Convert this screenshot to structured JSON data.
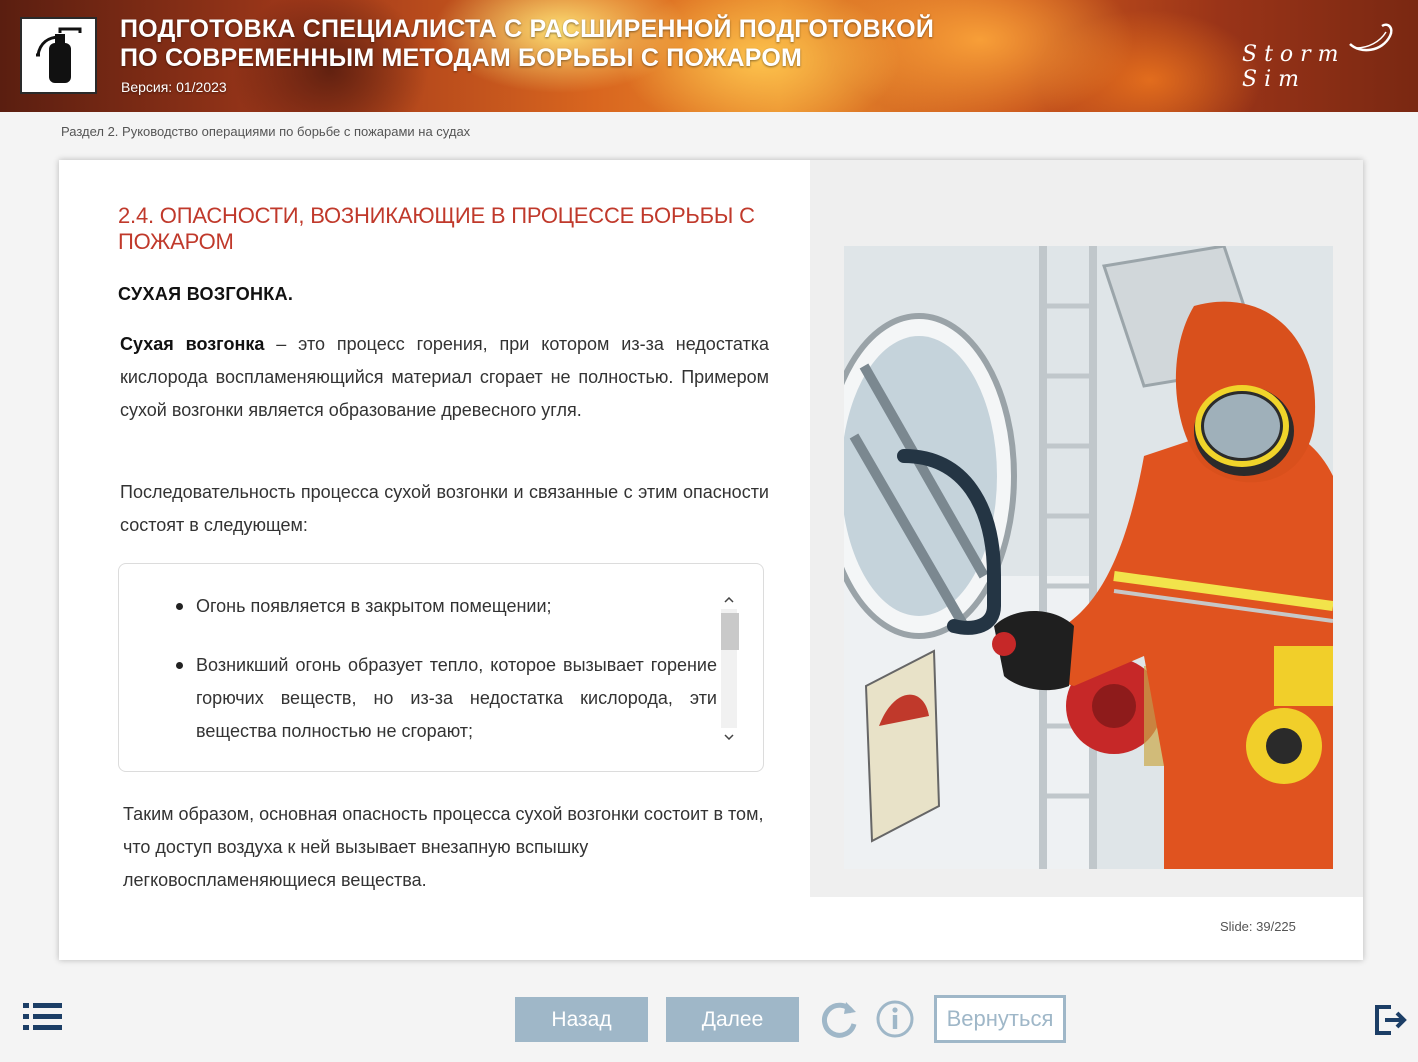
{
  "header": {
    "title_line1": "ПОДГОТОВКА СПЕЦИАЛИСТА С РАСШИРЕННОЙ ПОДГОТОВКОЙ",
    "title_line2": "ПО СОВРЕМЕННЫМ МЕТОДАМ БОРЬБЫ С ПОЖАРОМ",
    "version": "Версия: 01/2023",
    "logo_icon": "fire-extinguisher-icon",
    "brand_name": "Storm Sim"
  },
  "breadcrumb": "Раздел 2. Руководство операциями по борьбе с пожарами на судах",
  "content": {
    "section_title": "2.4. ОПАСНОСТИ, ВОЗНИКАЮЩИЕ В ПРОЦЕССЕ БОРЬБЫ С ПОЖАРОМ",
    "subheading": "СУХАЯ ВОЗГОНКА.",
    "p1_term": "Сухая возгонка",
    "p1_rest": " – это процесс горения, при котором из-за недостатка кислорода воспламеняющийся материал сгорает не полностью. Примером сухой возгонки является образование древесного угля.",
    "p2": "Последовательность процесса сухой возгонки и связанные с этим опасности состоят в следующем:",
    "bullets": [
      "Огонь появляется в закрытом помещении;",
      "Возникший огонь образует тепло, которое вызывает горение горючих веществ, но из-за недостатка кислорода, эти вещества полностью не сгорают;"
    ],
    "p3": "Таким образом, основная опасность процесса сухой возгонки состоит в том, что доступ воздуха к ней вызывает внезапную вспышку легковоспламеняющиеся вещества.",
    "slide_counter": "Slide: 39/225"
  },
  "footer": {
    "back_label": "Назад",
    "next_label": "Далее",
    "return_label": "Вернуться",
    "accent_color": "#9fb7c8"
  }
}
